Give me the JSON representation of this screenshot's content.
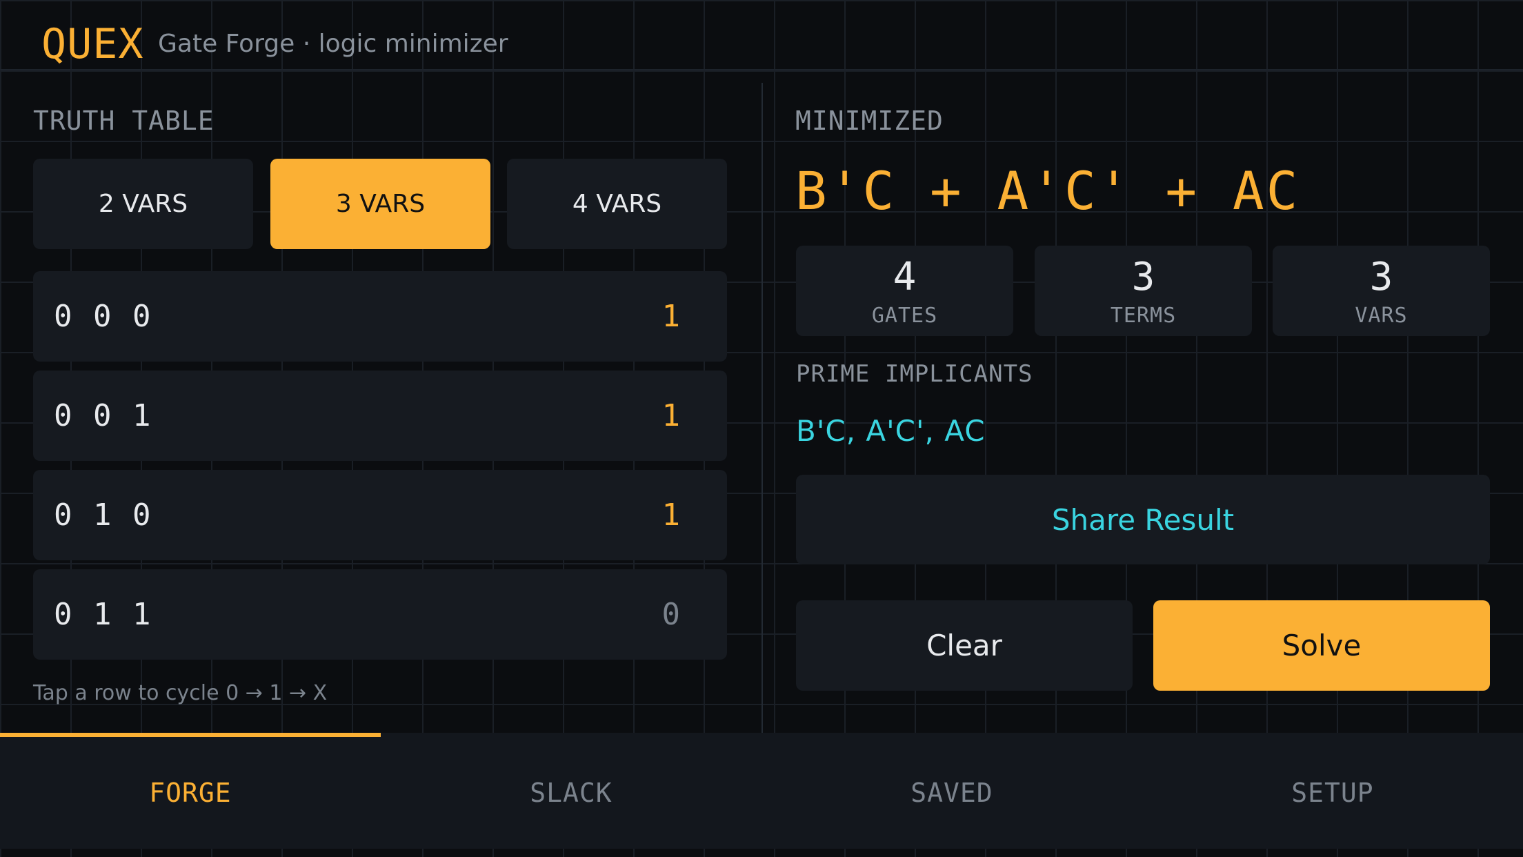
{
  "header": {
    "logo": "QUEX",
    "subtitle": "Gate Forge · logic minimizer"
  },
  "truth_table": {
    "label": "TRUTH TABLE",
    "var_tabs": [
      {
        "label": "2 VARS",
        "active": false
      },
      {
        "label": "3 VARS",
        "active": true
      },
      {
        "label": "4 VARS",
        "active": false
      }
    ],
    "rows": [
      {
        "inputs": "0 0 0",
        "output": "1"
      },
      {
        "inputs": "0 0 1",
        "output": "1"
      },
      {
        "inputs": "0 1 0",
        "output": "1"
      },
      {
        "inputs": "0 1 1",
        "output": "0"
      }
    ],
    "hint": "Tap a row to cycle 0 → 1 → X"
  },
  "minimized": {
    "label": "MINIMIZED",
    "expression": "B'C + A'C' + AC",
    "stats": [
      {
        "value": "4",
        "label": "GATES"
      },
      {
        "value": "3",
        "label": "TERMS"
      },
      {
        "value": "3",
        "label": "VARS"
      }
    ],
    "prime_label": "PRIME IMPLICANTS",
    "prime_implicants": "B'C, A'C', AC",
    "share_label": "Share Result",
    "clear_label": "Clear",
    "solve_label": "Solve"
  },
  "nav": {
    "tabs": [
      {
        "label": "FORGE",
        "active": true
      },
      {
        "label": "SLACK",
        "active": false
      },
      {
        "label": "SAVED",
        "active": false
      },
      {
        "label": "SETUP",
        "active": false
      }
    ]
  },
  "colors": {
    "accent": "#fbb034",
    "cyan": "#3ad4e0",
    "background": "#0b0d10",
    "card": "#161a20"
  }
}
